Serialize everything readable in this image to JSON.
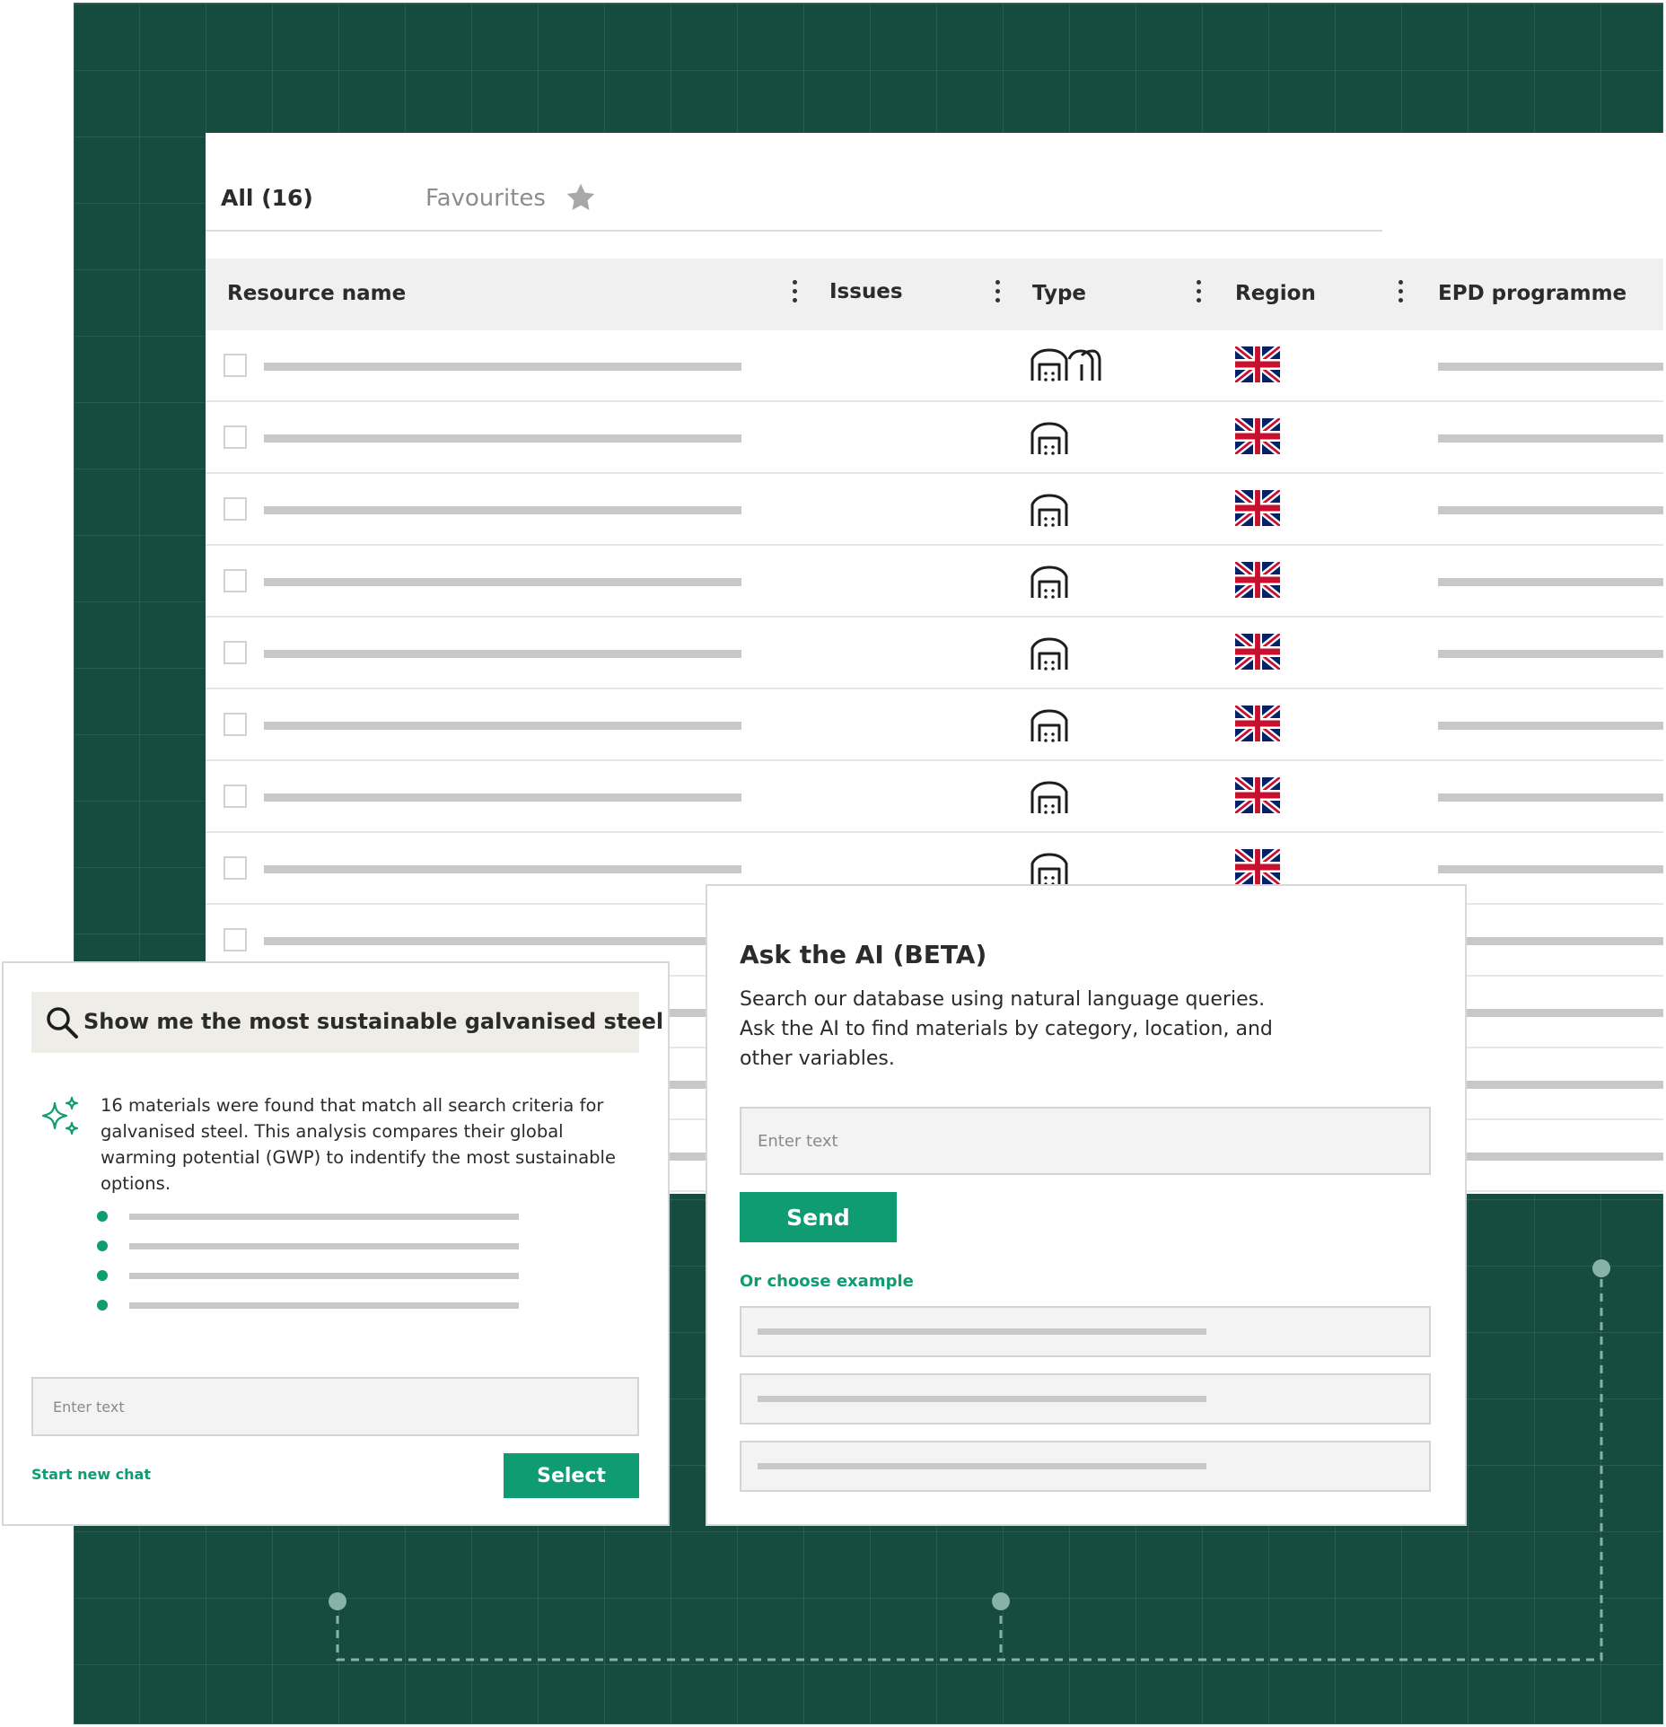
{
  "tabs": {
    "all_label": "All (16)",
    "favourites_label": "Favourites",
    "favourites_icon": "star-icon"
  },
  "table": {
    "columns": [
      {
        "label": "Resource name"
      },
      {
        "label": "Issues"
      },
      {
        "label": "Type"
      },
      {
        "label": "Region"
      },
      {
        "label": "EPD programme"
      }
    ],
    "rows": [
      {
        "type_icon": "multi-factory-icon",
        "region_icon": "uk-flag-icon"
      },
      {
        "type_icon": "factory-icon",
        "region_icon": "uk-flag-icon"
      },
      {
        "type_icon": "factory-icon",
        "region_icon": "uk-flag-icon"
      },
      {
        "type_icon": "factory-icon",
        "region_icon": "uk-flag-icon"
      },
      {
        "type_icon": "factory-icon",
        "region_icon": "uk-flag-icon"
      },
      {
        "type_icon": "factory-icon",
        "region_icon": "uk-flag-icon"
      },
      {
        "type_icon": "factory-icon",
        "region_icon": "uk-flag-icon"
      },
      {
        "type_icon": "factory-icon",
        "region_icon": "uk-flag-icon"
      },
      {
        "type_icon": "",
        "region_icon": ""
      },
      {
        "type_icon": "",
        "region_icon": ""
      },
      {
        "type_icon": "",
        "region_icon": ""
      },
      {
        "type_icon": "",
        "region_icon": ""
      },
      {
        "type_icon": "",
        "region_icon": ""
      }
    ]
  },
  "chat": {
    "query": "Show me the most sustainable  galvanised steel",
    "answer": "16 materials were found that match all search criteria for galvanised steel. This analysis compares their global warming potential (GWP) to indentify the most sustainable options.",
    "bullet_count": 4,
    "input_placeholder": "Enter text",
    "start_new_chat_label": "Start new chat",
    "select_label": "Select"
  },
  "ai": {
    "title": "Ask the AI (BETA)",
    "description_line1": "Search our database using natural language queries.",
    "description_line2": "Ask the AI to find materials by category, location, and",
    "description_line3": "other variables.",
    "input_placeholder": "Enter text",
    "send_label": "Send",
    "example_label": "Or choose example",
    "example_count": 3
  },
  "colors": {
    "background_green": "#164b3f",
    "accent_green": "#0f9c72",
    "placeholder_bar": "#c8c8c8",
    "header_bg": "#f0f0f0",
    "query_bg": "#efede8"
  }
}
